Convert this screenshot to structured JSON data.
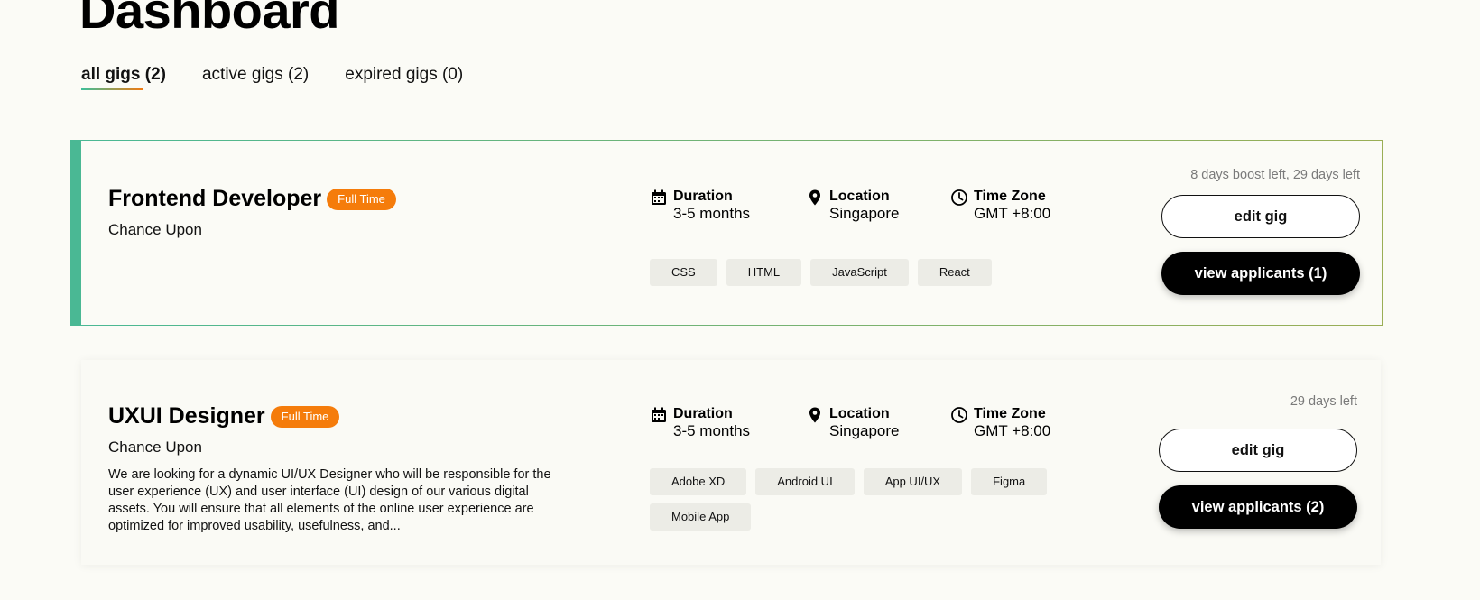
{
  "page": {
    "title": "Dashboard"
  },
  "tabs": [
    {
      "label": "all gigs (2)",
      "active": true
    },
    {
      "label": "active gigs (2)",
      "active": false
    },
    {
      "label": "expired gigs (0)",
      "active": false
    }
  ],
  "meta_labels": {
    "duration": "Duration",
    "location": "Location",
    "timezone": "Time Zone"
  },
  "icons": {
    "duration": "calendar-icon",
    "location": "map-pin-icon",
    "timezone": "clock-icon"
  },
  "colors": {
    "badge": "#f57c0b",
    "accent_green": "#4ab894",
    "accent_olive": "#8fa860",
    "primary_button": "#000000"
  },
  "gigs": [
    {
      "title": "Frontend Developer",
      "badge": "Full Time",
      "company": "Chance Upon",
      "description": "",
      "duration": "3-5 months",
      "location": "Singapore",
      "timezone": "GMT +8:00",
      "skills": [
        "CSS",
        "HTML",
        "JavaScript",
        "React"
      ],
      "time_left": "8 days boost left, 29 days left",
      "edit_label": "edit gig",
      "view_label": "view applicants (1)"
    },
    {
      "title": "UXUI Designer",
      "badge": "Full Time",
      "company": "Chance Upon",
      "description": "We are looking for a dynamic UI/UX Designer who will be responsible for the user experience (UX) and user interface (UI) design of our various digital assets. You will ensure that all elements of the online user experience are optimized for improved usability, usefulness, and...",
      "duration": "3-5 months",
      "location": "Singapore",
      "timezone": "GMT +8:00",
      "skills": [
        "Adobe XD",
        "Android UI",
        "App UI/UX",
        "Figma",
        "Mobile App"
      ],
      "time_left": "29 days left",
      "edit_label": "edit gig",
      "view_label": "view applicants (2)"
    }
  ]
}
